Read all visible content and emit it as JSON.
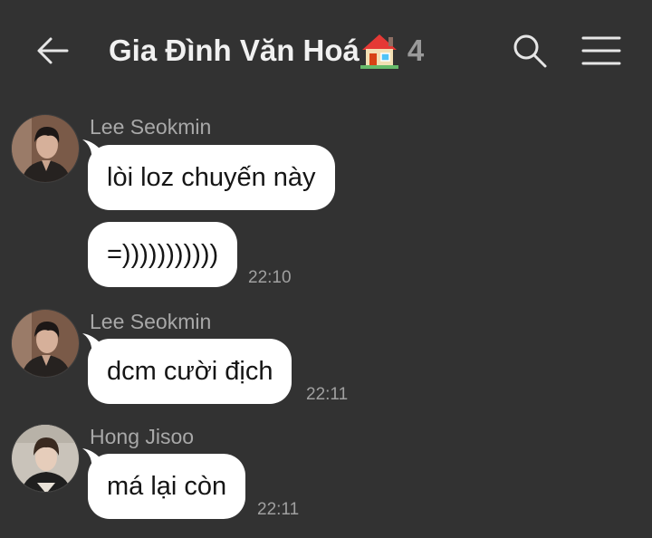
{
  "header": {
    "back_icon": "arrow-left-icon",
    "title": "Gia Đình Văn Hoá",
    "title_emoji": "house-emoji-icon",
    "member_count": "4",
    "search_icon": "search-icon",
    "menu_icon": "hamburger-menu-icon"
  },
  "messages": [
    {
      "sender": "Lee Seokmin",
      "avatar": "avatar-lee-seokmin",
      "text": "lòi loz chuyến này",
      "time": ""
    },
    {
      "sender": "",
      "text": "=)))))))))))",
      "time": "22:10"
    },
    {
      "sender": "Lee Seokmin",
      "avatar": "avatar-lee-seokmin",
      "text": "dcm cười địch",
      "time": "22:11"
    },
    {
      "sender": "Hong Jisoo",
      "avatar": "avatar-hong-jisoo",
      "text": "má lại còn",
      "time": "22:11"
    }
  ],
  "colors": {
    "background": "#323232",
    "bubble": "#ffffff",
    "header_text": "#f1f1f1",
    "muted_text": "#a0a0a0"
  }
}
